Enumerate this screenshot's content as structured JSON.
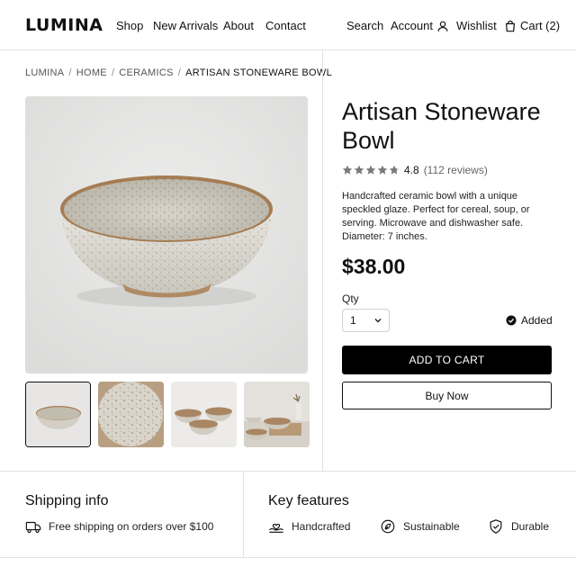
{
  "header": {
    "logo": "LUMINA",
    "nav": [
      "Shop",
      "New Arrivals",
      "About",
      "Contact"
    ],
    "search": "Search",
    "account": "Account",
    "wishlist": "Wishlist",
    "cart": "Cart (2)"
  },
  "breadcrumb": {
    "items": [
      "LUMINA",
      "HOME",
      "CERAMICS"
    ],
    "current": "ARTISAN STONEWARE BOWL",
    "separator": "/"
  },
  "gallery": {
    "main_alt": "speckled stoneware bowl",
    "thumbnails": [
      "bowl-side",
      "bowl-top",
      "bowl-set",
      "table-setting"
    ],
    "active_index": 0
  },
  "product": {
    "title": "Artisan Stoneware Bowl",
    "rating": "4.8",
    "rating_value": 4.8,
    "reviews": "(112 reviews)",
    "description": "Handcrafted ceramic bowl with a unique speckled glaze. Perfect for cereal, soup, or serving. Microwave and dishwasher safe. Diameter: 7 inches.",
    "price": "$38.00",
    "qty_label": "Qty",
    "qty_value": "1",
    "added_label": "Added",
    "add_to_cart": "ADD TO CART",
    "buy_now": "Buy Now"
  },
  "shipping": {
    "title": "Shipping info",
    "text": "Free shipping on orders over $100"
  },
  "features": {
    "title": "Key features",
    "items": [
      "Handcrafted",
      "Sustainable",
      "Durable"
    ]
  },
  "colors": {
    "accent": "#000000",
    "border": "#e2e2e2",
    "star": "#7a7a7a"
  }
}
